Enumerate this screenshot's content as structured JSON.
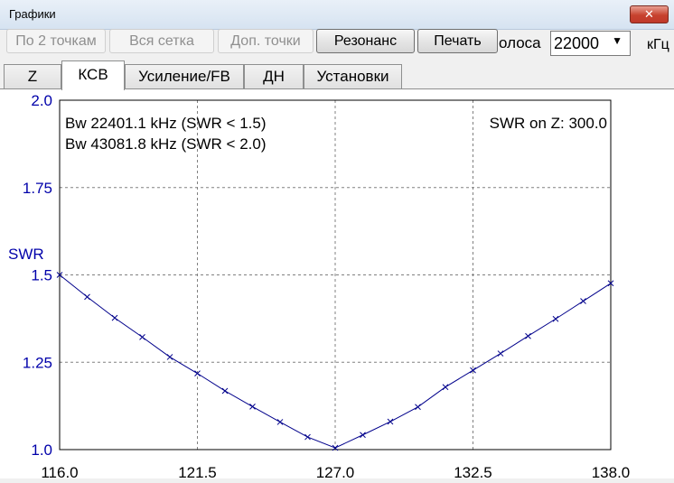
{
  "window": {
    "title": "Графики",
    "close_glyph": "✕"
  },
  "toolbar": {
    "buttons": [
      {
        "label": "По 2 точкам",
        "enabled": false
      },
      {
        "label": "Вся сетка",
        "enabled": false
      },
      {
        "label": "Доп. точки",
        "enabled": false
      },
      {
        "label": "Резонанс",
        "enabled": true
      },
      {
        "label": "Печать",
        "enabled": true
      }
    ],
    "band_label": "олоса",
    "band_value": "22000",
    "band_arrow": "▼",
    "unit_label": "кГц"
  },
  "tabs": [
    {
      "label": "Z",
      "active": false
    },
    {
      "label": "КСВ",
      "active": true
    },
    {
      "label": "Усиление/FB",
      "active": false
    },
    {
      "label": "ДН",
      "active": false
    },
    {
      "label": "Установки",
      "active": false
    }
  ],
  "colors": {
    "curve": "#00008b",
    "axis_labels": "#0000aa",
    "grid": "#808080",
    "text": "#000000"
  },
  "chart_data": {
    "type": "line",
    "ylabel": "SWR",
    "xlim": [
      116.0,
      138.0
    ],
    "ylim": [
      1.0,
      2.0
    ],
    "grid": true,
    "y_ticks": [
      {
        "value": 2.0,
        "label": "2.0"
      },
      {
        "value": 1.75,
        "label": "1.75"
      },
      {
        "value": 1.5,
        "label": "1.5"
      },
      {
        "value": 1.25,
        "label": "1.25"
      },
      {
        "value": 1.0,
        "label": "1.0"
      }
    ],
    "x_ticks": [
      {
        "value": 116.0,
        "label": "116.0"
      },
      {
        "value": 121.5,
        "label": "121.5"
      },
      {
        "value": 127.0,
        "label": "127.0"
      },
      {
        "value": 132.5,
        "label": "132.5"
      },
      {
        "value": 138.0,
        "label": "138.0"
      }
    ],
    "annotations": {
      "bw1": "Bw 22401.1 kHz (SWR < 1.5)",
      "bw2": "Bw 43081.8 kHz (SWR < 2.0)",
      "swr_on_z": "SWR on Z: 300.0"
    },
    "series": [
      {
        "x": [
          116.0,
          117.1,
          118.2,
          119.3,
          120.4,
          121.5,
          122.6,
          123.7,
          124.8,
          125.9,
          127.0,
          128.1,
          129.2,
          130.3,
          131.4,
          132.5,
          133.6,
          134.7,
          135.8,
          136.9,
          138.0
        ],
        "y": [
          1.5,
          1.437,
          1.377,
          1.322,
          1.265,
          1.218,
          1.168,
          1.123,
          1.079,
          1.036,
          1.005,
          1.042,
          1.08,
          1.122,
          1.179,
          1.227,
          1.275,
          1.325,
          1.374,
          1.425,
          1.476
        ]
      }
    ]
  }
}
